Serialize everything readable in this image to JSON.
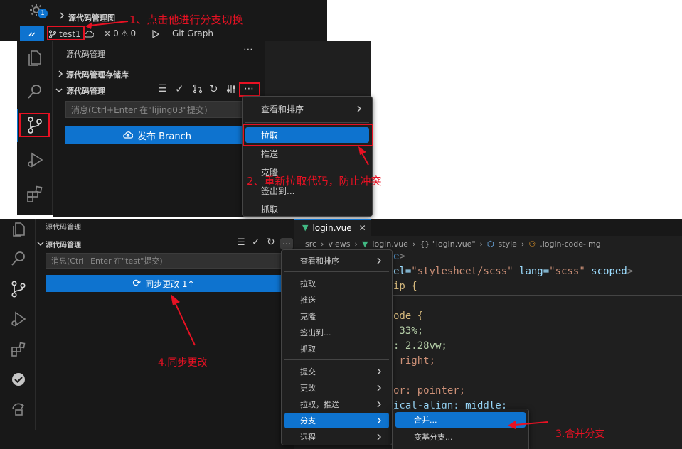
{
  "colors": {
    "accent": "#0e73cf",
    "annotation": "#e81123",
    "menu_bg": "#1f1f1f",
    "editor_bg": "#1f1f1f"
  },
  "top_strip": {
    "scm_graph_label": "源代码管理图",
    "badge_count": "1",
    "annotation_1": "1、点击他进行分支切换"
  },
  "status_bar": {
    "branch": "test1",
    "errors": "0",
    "warnings": "0",
    "git_graph": "Git Graph"
  },
  "panel1": {
    "header": "源代码管理",
    "repos_section": "源代码管理存储库",
    "scm_section": "源代码管理",
    "message_placeholder": "消息(Ctrl+Enter 在\"lijing03\"提交)",
    "publish_button": "发布 Branch",
    "menu": [
      "查看和排序",
      "拉取",
      "推送",
      "克隆",
      "签出到...",
      "抓取"
    ],
    "annotation_2": "2、重新拉取代码，防止冲突"
  },
  "panel2": {
    "header": "源代码管理",
    "scm_section": "源代码管理",
    "message_placeholder": "消息(Ctrl+Enter 在\"test\"提交)",
    "sync_button": "同步更改 1↑",
    "annotation_4": "4.同步更改",
    "menu": {
      "group1": [
        "查看和排序"
      ],
      "group2": [
        "拉取",
        "推送",
        "克隆",
        "签出到...",
        "抓取"
      ],
      "group3": [
        "提交",
        "更改",
        "拉取，推送",
        "分支",
        "远程"
      ]
    },
    "submenu": [
      "合并...",
      "变基分支..."
    ],
    "annotation_3": "3.合并分支"
  },
  "editor": {
    "tab": "login.vue",
    "breadcrumb": [
      "src",
      "views",
      "login.vue",
      "{} \"login.vue\"",
      "style",
      ".login-code-img"
    ],
    "code_lines": [
      {
        "a": "e",
        "b": ">"
      },
      {
        "a": "el=",
        "b": "\"stylesheet/scss\"",
        "c": " lang=",
        "d": "\"scss\"",
        "e": " scoped",
        "f": ">"
      },
      {
        "a": "ip {"
      },
      {
        "a": ""
      },
      {
        "a": "ode {"
      },
      {
        "a": " 33%;"
      },
      {
        "a": ": 2.28vw;"
      },
      {
        "a": " right;"
      },
      {
        "a": ""
      },
      {
        "a": "or: pointer;"
      },
      {
        "a": "ical-align: middle;"
      }
    ]
  }
}
